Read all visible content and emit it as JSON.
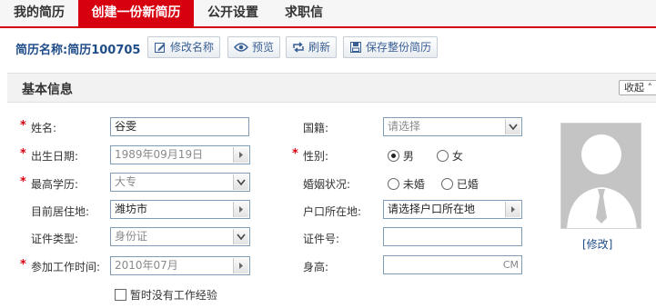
{
  "tabs": [
    {
      "label": "我的简历",
      "active": false
    },
    {
      "label": "创建一份新简历",
      "active": true
    },
    {
      "label": "公开设置",
      "active": false
    },
    {
      "label": "求职信",
      "active": false
    }
  ],
  "resume": {
    "name_label": "简历名称:简历100705"
  },
  "toolbar": {
    "rename": "修改名称",
    "preview": "预览",
    "refresh": "刷新",
    "save": "保存整份简历"
  },
  "section": {
    "title": "基本信息",
    "collapse_label": "收起 ˄"
  },
  "form": {
    "name": {
      "label": "姓名:",
      "value": "谷雯"
    },
    "nationality": {
      "label": "国籍:",
      "value": "请选择"
    },
    "birth": {
      "label": "出生日期:",
      "value": "1989年09月19日"
    },
    "gender": {
      "label": "性别:",
      "options": [
        "男",
        "女"
      ],
      "selected": "男"
    },
    "education": {
      "label": "最高学历:",
      "value": "大专"
    },
    "marital": {
      "label": "婚姻状况:",
      "options": [
        "未婚",
        "已婚"
      ],
      "selected": ""
    },
    "residence": {
      "label": "目前居住地:",
      "value": "潍坊市"
    },
    "hukou": {
      "label": "户口所在地:",
      "value": "请选择户口所在地"
    },
    "idtype": {
      "label": "证件类型:",
      "value": "身份证"
    },
    "idnum": {
      "label": "证件号:",
      "value": ""
    },
    "workstart": {
      "label": "参加工作时间:",
      "value": "2010年07月"
    },
    "height": {
      "label": "身高:",
      "unit": "CM"
    },
    "no_experience": {
      "label": "暂时没有工作经验",
      "checked": false
    },
    "required_mark": "*"
  },
  "photo": {
    "edit_label": "[修改]"
  },
  "colors": {
    "accent": "#d7000f",
    "link": "#1f4d8a"
  }
}
